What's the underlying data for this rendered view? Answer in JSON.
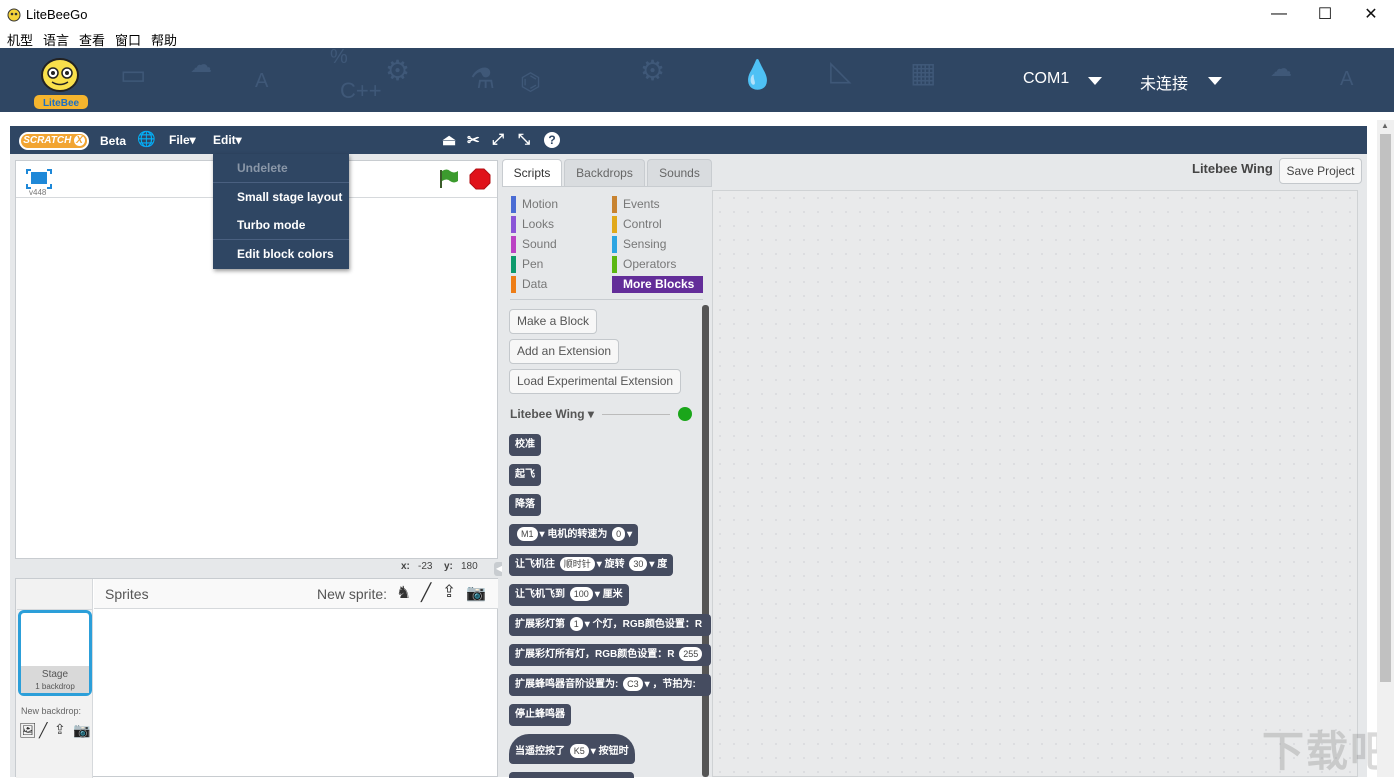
{
  "window": {
    "title": "LiteBeeGo",
    "minimize": "—",
    "maximize": "☐",
    "close": "✕"
  },
  "menubar": [
    "机型",
    "语言",
    "查看",
    "窗口",
    "帮助"
  ],
  "banner": {
    "port": "COM1",
    "status": "未连接"
  },
  "scratch": {
    "logo": "SCRATCH",
    "logo_badge": "X",
    "beta": "Beta",
    "file_menu": "File",
    "edit_menu": "Edit"
  },
  "edit_dropdown": [
    "Undelete",
    "Small stage layout",
    "Turbo mode",
    "Edit block colors"
  ],
  "stage": {
    "version": "v448",
    "x_label": "x:",
    "x_value": "-23",
    "y_label": "y:",
    "y_value": "180"
  },
  "sprites": {
    "title": "Sprites",
    "new_sprite": "New sprite:",
    "stage_label": "Stage",
    "stage_sub": "1 backdrop",
    "new_backdrop": "New backdrop:"
  },
  "tabs": [
    "Scripts",
    "Backdrops",
    "Sounds"
  ],
  "categories": {
    "left": [
      {
        "label": "Motion",
        "color": "#4a6cd4"
      },
      {
        "label": "Looks",
        "color": "#8a55d7"
      },
      {
        "label": "Sound",
        "color": "#bb42c3"
      },
      {
        "label": "Pen",
        "color": "#0e9a6c"
      },
      {
        "label": "Data",
        "color": "#ee7d16"
      }
    ],
    "right": [
      {
        "label": "Events",
        "color": "#c88330"
      },
      {
        "label": "Control",
        "color": "#e1a91a"
      },
      {
        "label": "Sensing",
        "color": "#2ca5e2"
      },
      {
        "label": "Operators",
        "color": "#5cb712"
      },
      {
        "label": "More Blocks",
        "color": "#632d99"
      }
    ]
  },
  "palette_buttons": [
    "Make a Block",
    "Add an Extension",
    "Load Experimental Extension"
  ],
  "extension": {
    "name": "Litebee Wing"
  },
  "blocks": {
    "b1": "校准",
    "b2": "起飞",
    "b3": "降落",
    "b4_slot1": "M1",
    "b4_text": "电机的转速为",
    "b4_slot2": "0",
    "b5_text1": "让飞机往",
    "b5_slot1": "顺时针",
    "b5_text2": "旋转",
    "b5_slot2": "30",
    "b5_text3": "度",
    "b6_text1": "让飞机飞到",
    "b6_slot1": "100",
    "b6_text2": "厘米",
    "b7_text1": "扩展彩灯第",
    "b7_slot1": "1",
    "b7_text2": "个灯，RGB颜色设置：R",
    "b8_text1": "扩展彩灯所有灯，RGB颜色设置：R",
    "b8_slot1": "255",
    "b9_text1": "扩展蜂鸣器音阶设置为:",
    "b9_slot1": "C3",
    "b9_text2": "，节拍为:",
    "b10": "停止蜂鸣器",
    "b11_text1": "当遥控按了",
    "b11_slot1": "K5",
    "b11_text2": "按钮时"
  },
  "scripts_header": {
    "sprite_name": "Litebee Wing",
    "save_button": "Save Project"
  },
  "watermark": "下载吧"
}
